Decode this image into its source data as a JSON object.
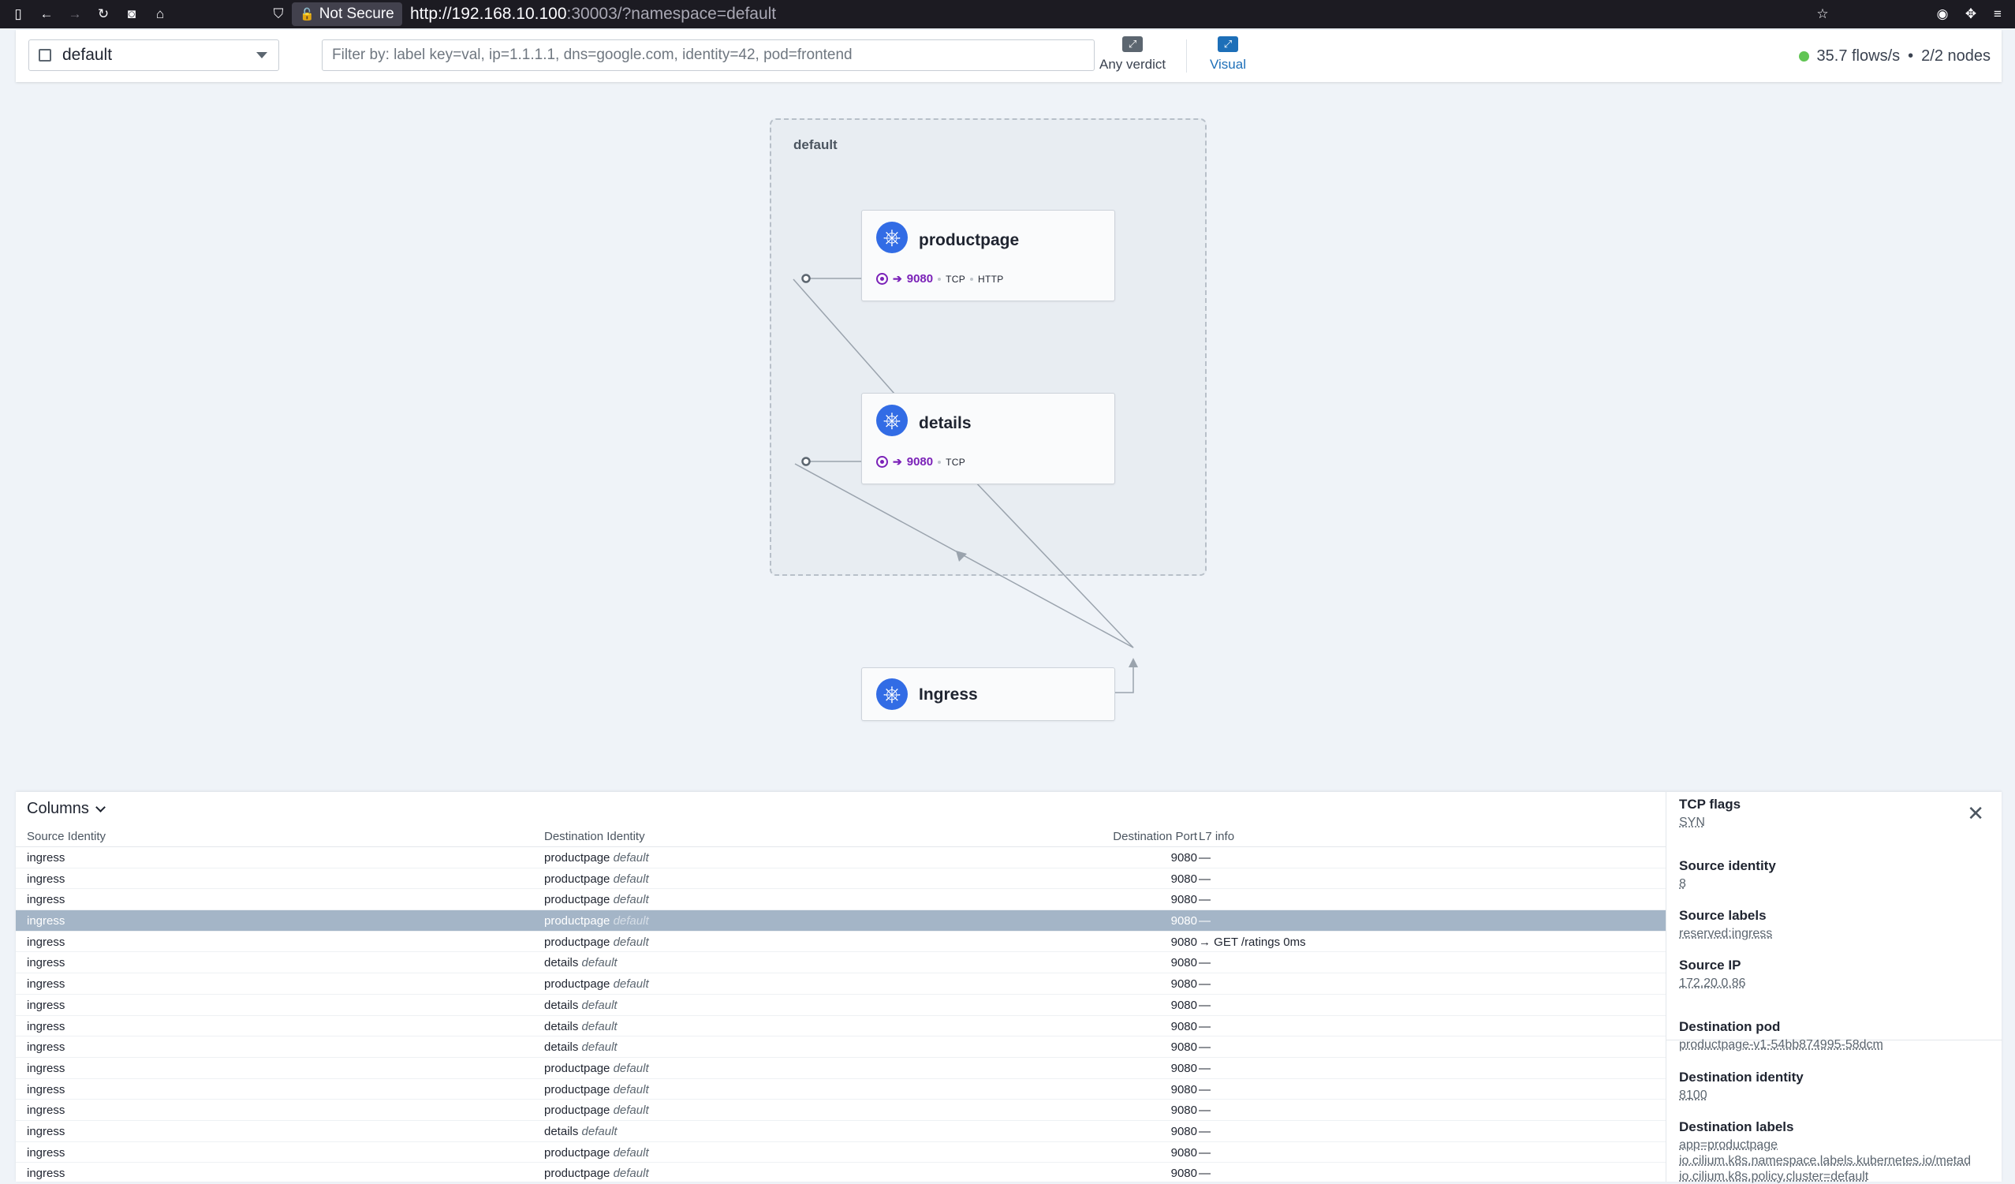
{
  "browser": {
    "security": "Not Secure",
    "url_host": "http://192.168.10.100",
    "url_rest": ":30003/?namespace=default"
  },
  "toolbar": {
    "namespace": "default",
    "filter_placeholder": "Filter by: label key=val, ip=1.1.1.1, dns=google.com, identity=42, pod=frontend",
    "verdict_label": "Any verdict",
    "visual_label": "Visual",
    "flows_rate": "35.7 flows/s",
    "nodes": "2/2 nodes"
  },
  "graph": {
    "namespace_label": "default",
    "services": [
      {
        "name": "productpage",
        "port": "9080",
        "protocols": [
          "TCP",
          "HTTP"
        ]
      },
      {
        "name": "details",
        "port": "9080",
        "protocols": [
          "TCP"
        ]
      },
      {
        "name": "Ingress"
      }
    ]
  },
  "flows": {
    "columns_button": "Columns",
    "headers": {
      "source": "Source Identity",
      "destination": "Destination Identity",
      "port": "Destination Port",
      "l7": "L7 info"
    },
    "rows": [
      {
        "src": "ingress",
        "dst": "productpage",
        "dst_ns": "default",
        "port": "9080",
        "l7": "—"
      },
      {
        "src": "ingress",
        "dst": "productpage",
        "dst_ns": "default",
        "port": "9080",
        "l7": "—"
      },
      {
        "src": "ingress",
        "dst": "productpage",
        "dst_ns": "default",
        "port": "9080",
        "l7": "—"
      },
      {
        "src": "ingress",
        "dst": "productpage",
        "dst_ns": "default",
        "port": "9080",
        "l7": "—",
        "selected": true
      },
      {
        "src": "ingress",
        "dst": "productpage",
        "dst_ns": "default",
        "port": "9080",
        "l7": "→ GET /ratings 0ms"
      },
      {
        "src": "ingress",
        "dst": "details",
        "dst_ns": "default",
        "port": "9080",
        "l7": "—"
      },
      {
        "src": "ingress",
        "dst": "productpage",
        "dst_ns": "default",
        "port": "9080",
        "l7": "—"
      },
      {
        "src": "ingress",
        "dst": "details",
        "dst_ns": "default",
        "port": "9080",
        "l7": "—"
      },
      {
        "src": "ingress",
        "dst": "details",
        "dst_ns": "default",
        "port": "9080",
        "l7": "—"
      },
      {
        "src": "ingress",
        "dst": "details",
        "dst_ns": "default",
        "port": "9080",
        "l7": "—"
      },
      {
        "src": "ingress",
        "dst": "productpage",
        "dst_ns": "default",
        "port": "9080",
        "l7": "—"
      },
      {
        "src": "ingress",
        "dst": "productpage",
        "dst_ns": "default",
        "port": "9080",
        "l7": "—"
      },
      {
        "src": "ingress",
        "dst": "productpage",
        "dst_ns": "default",
        "port": "9080",
        "l7": "—"
      },
      {
        "src": "ingress",
        "dst": "details",
        "dst_ns": "default",
        "port": "9080",
        "l7": "—"
      },
      {
        "src": "ingress",
        "dst": "productpage",
        "dst_ns": "default",
        "port": "9080",
        "l7": "—"
      },
      {
        "src": "ingress",
        "dst": "productpage",
        "dst_ns": "default",
        "port": "9080",
        "l7": "—"
      }
    ]
  },
  "details": {
    "tcp_flags_label": "TCP flags",
    "tcp_flags": "SYN",
    "source_identity_label": "Source identity",
    "source_identity": "8",
    "source_labels_label": "Source labels",
    "source_labels": "reserved:ingress",
    "source_ip_label": "Source IP",
    "source_ip": "172.20.0.86",
    "destination_pod_label": "Destination pod",
    "destination_pod": "productpage-v1-54bb874995-58dcm",
    "destination_identity_label": "Destination identity",
    "destination_identity": "8100",
    "destination_labels_label": "Destination labels",
    "destination_labels": [
      "app=productpage",
      "io.cilium.k8s.namespace.labels.kubernetes.io/metad",
      "io.cilium.k8s.policy.cluster=default"
    ]
  },
  "colors": {
    "accent": "#326ce5",
    "visual_active": "#1d6fb8",
    "port_purple": "#7b22b8",
    "status_green": "#61c554",
    "selected_row": "#a4b5c7"
  }
}
